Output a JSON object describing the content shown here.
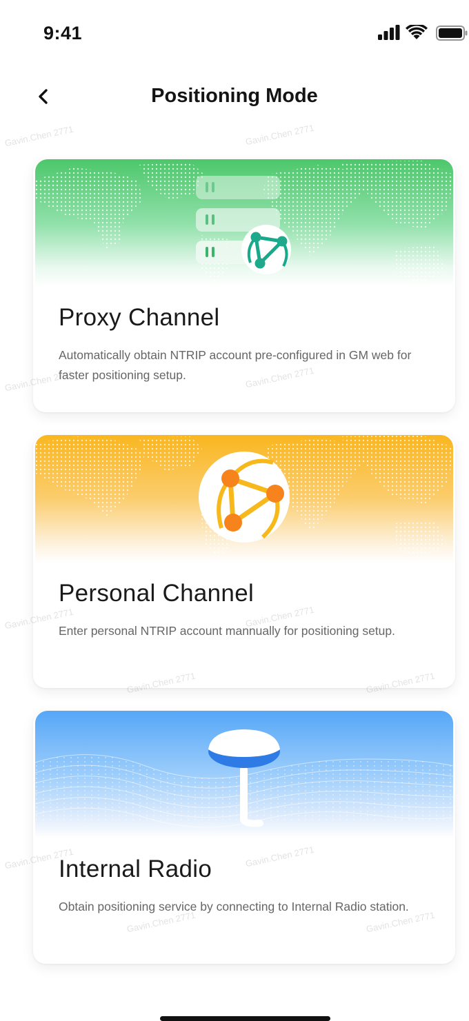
{
  "status": {
    "time": "9:41"
  },
  "nav": {
    "title": "Positioning Mode",
    "back_icon": "chevron-left-icon"
  },
  "watermark": {
    "text": "Gavin.Chen 2771"
  },
  "cards": [
    {
      "title": "Proxy Channel",
      "description": "Automatically obtain NTRIP account pre-configured in GM web for faster positioning setup.",
      "illustration": "server-network-icon",
      "accent": "#4cc66a"
    },
    {
      "title": "Personal Channel",
      "description": "Enter personal NTRIP account mannually for positioning setup.",
      "illustration": "globe-network-icon",
      "accent": "#f8b424"
    },
    {
      "title": "Internal Radio",
      "description": "Obtain positioning service by connecting to Internal Radio station.",
      "illustration": "antenna-icon",
      "accent": "#5aa8f8"
    }
  ]
}
